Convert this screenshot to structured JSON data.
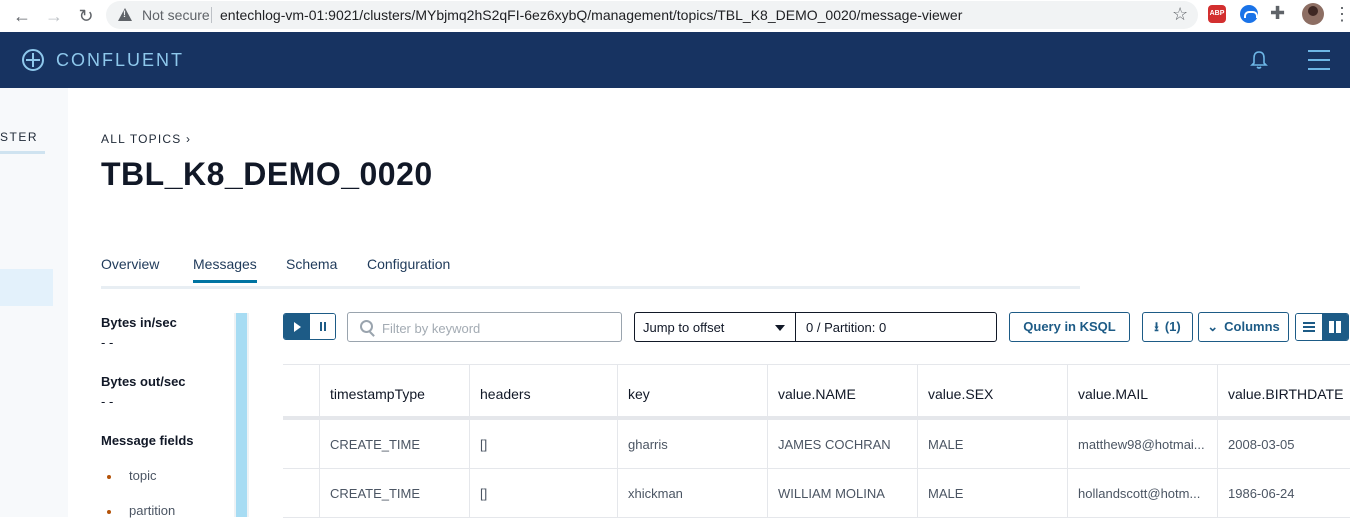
{
  "browser": {
    "not_secure_label": "Not secure",
    "url": "entechlog-vm-01:9021/clusters/MYbjmq2hS2qFI-6ez6xybQ/management/topics/TBL_K8_DEMO_0020/message-viewer",
    "abp_label": "ABP"
  },
  "header": {
    "brand": "CONFLUENT"
  },
  "sidebar": {
    "cluster_label": "STER"
  },
  "breadcrumb": {
    "label": "ALL TOPICS ›"
  },
  "page": {
    "title": "TBL_K8_DEMO_0020"
  },
  "tabs": [
    {
      "label": "Overview"
    },
    {
      "label": "Messages"
    },
    {
      "label": "Schema"
    },
    {
      "label": "Configuration"
    }
  ],
  "metrics": {
    "bytes_in_label": "Bytes in/sec",
    "bytes_in_value": "- -",
    "bytes_out_label": "Bytes out/sec",
    "bytes_out_value": "- -",
    "fields_label": "Message fields",
    "fields": [
      "topic",
      "partition"
    ]
  },
  "toolbar": {
    "filter_placeholder": "Filter by keyword",
    "jump_label": "Jump to offset",
    "offset_text": "0 / Partition: 0",
    "ksql_label": "Query in KSQL",
    "download_label": "(1)",
    "columns_label": "Columns"
  },
  "table": {
    "columns": [
      "timestampType",
      "headers",
      "key",
      "value.NAME",
      "value.SEX",
      "value.MAIL",
      "value.BIRTHDATE"
    ],
    "rows": [
      [
        "CREATE_TIME",
        "[]",
        "gharris",
        "JAMES COCHRAN",
        "MALE",
        "matthew98@hotmai...",
        "2008-03-05"
      ],
      [
        "CREATE_TIME",
        "[]",
        "xhickman",
        "WILLIAM MOLINA",
        "MALE",
        "hollandscott@hotm...",
        "1986-06-24"
      ]
    ]
  },
  "colors": {
    "header_bg": "#173361",
    "brand_accent": "#8ec8ec",
    "primary": "#1d5b86",
    "active_tab_underline": "#0074a2"
  }
}
